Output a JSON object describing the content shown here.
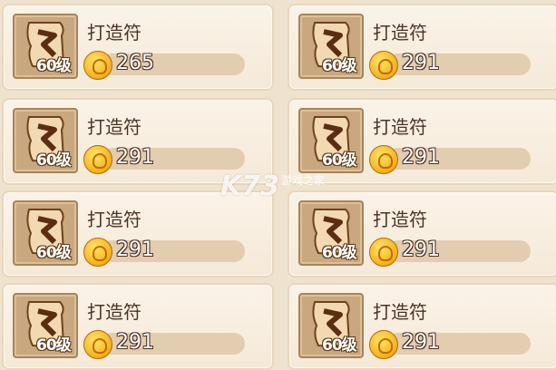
{
  "items": [
    {
      "name": "打造符",
      "level": "60级",
      "price": "265"
    },
    {
      "name": "打造符",
      "level": "60级",
      "price": "291"
    },
    {
      "name": "打造符",
      "level": "60级",
      "price": "291"
    },
    {
      "name": "打造符",
      "level": "60级",
      "price": "291"
    },
    {
      "name": "打造符",
      "level": "60级",
      "price": "291"
    },
    {
      "name": "打造符",
      "level": "60级",
      "price": "291"
    },
    {
      "name": "打造符",
      "level": "60级",
      "price": "291"
    },
    {
      "name": "打造符",
      "level": "60级",
      "price": "291"
    }
  ],
  "watermark": {
    "logo": "K73",
    "sub": "游戏之家"
  },
  "colors": {
    "panel": "#f7ecdd",
    "slot": "#c9a77f",
    "coin": "#f3b01c",
    "text": "#4a3426"
  }
}
